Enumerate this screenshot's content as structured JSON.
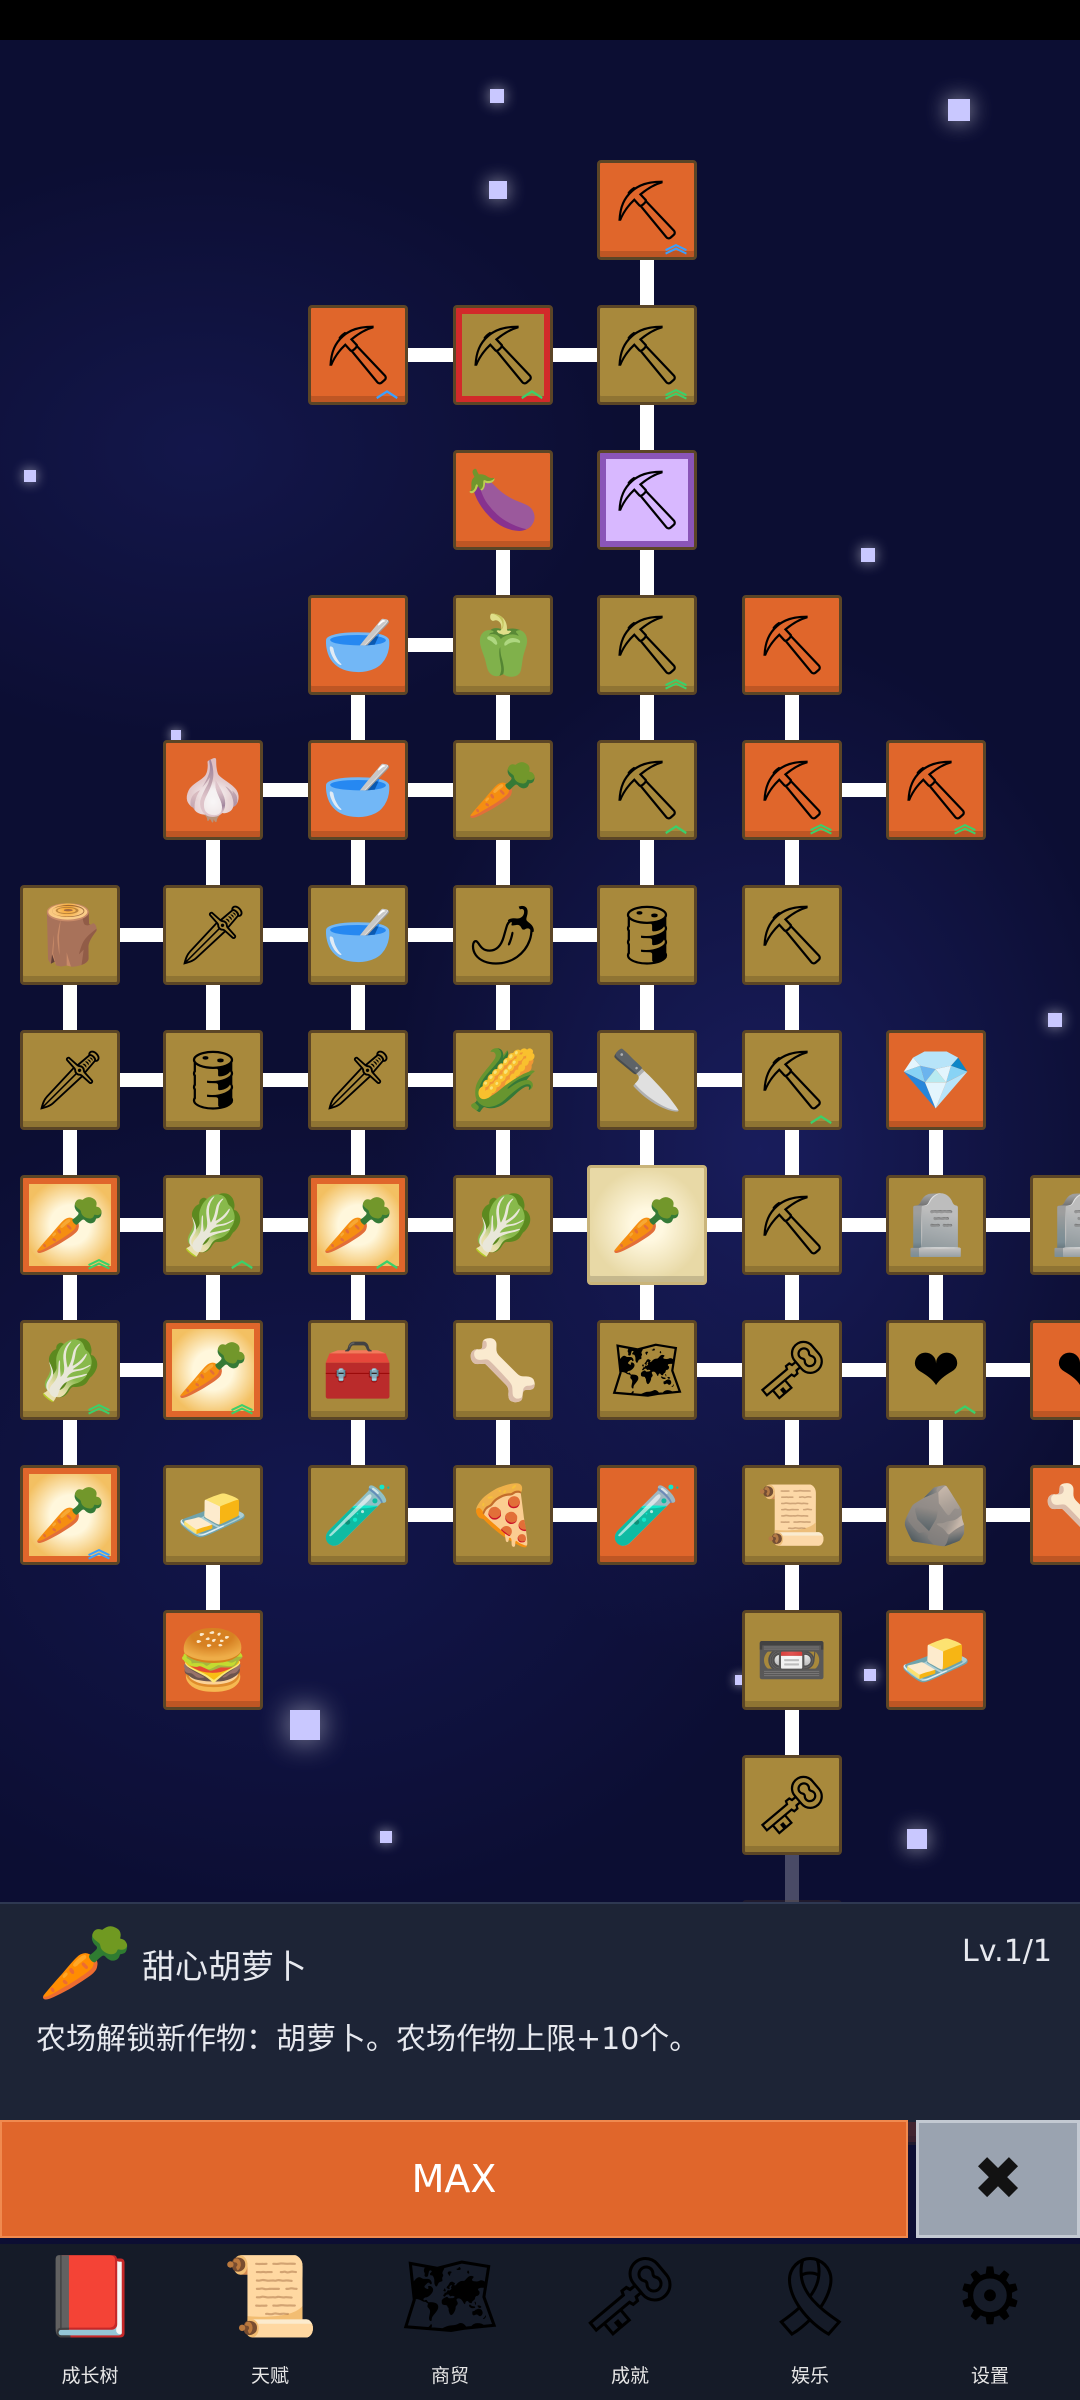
{
  "tree": {
    "nodes": [
      {
        "id": "n1",
        "col": 4,
        "row": 0,
        "bg": "orange",
        "icon": "shovel-icon",
        "glyph": "⛏",
        "up": "︽",
        "upColor": "#3aa0ff"
      },
      {
        "id": "n2",
        "col": 2,
        "row": 1,
        "bg": "orange",
        "icon": "shovel-icon",
        "glyph": "⛏",
        "up": "︿",
        "upColor": "#3aa0ff"
      },
      {
        "id": "n3",
        "col": 3,
        "row": 1,
        "bg": "red-frame",
        "icon": "shovel-icon",
        "glyph": "⛏",
        "up": "︿",
        "upColor": "#3ad06a"
      },
      {
        "id": "n4",
        "col": 4,
        "row": 1,
        "bg": "gold",
        "icon": "shovel-icon",
        "glyph": "⛏",
        "up": "︽",
        "upColor": "#3ad06a"
      },
      {
        "id": "n5",
        "col": 3,
        "row": 2,
        "bg": "orange",
        "icon": "eggplant-icon",
        "glyph": "🍆"
      },
      {
        "id": "n6",
        "col": 4,
        "row": 2,
        "bg": "purple",
        "icon": "shovel-icon",
        "glyph": "⛏"
      },
      {
        "id": "n7",
        "col": 2,
        "row": 3,
        "bg": "orange",
        "icon": "bowl-icon",
        "glyph": "🥣"
      },
      {
        "id": "n8",
        "col": 3,
        "row": 3,
        "bg": "gold",
        "icon": "pepper-icon",
        "glyph": "🫑"
      },
      {
        "id": "n9",
        "col": 4,
        "row": 3,
        "bg": "gold",
        "icon": "shovel-icon",
        "glyph": "⛏",
        "up": "︽",
        "upColor": "#3ad06a"
      },
      {
        "id": "n10",
        "col": 5,
        "row": 3,
        "bg": "orange",
        "icon": "pickaxe-icon",
        "glyph": "⛏"
      },
      {
        "id": "n11",
        "col": 1,
        "row": 4,
        "bg": "orange",
        "icon": "garlic-icon",
        "glyph": "🧄"
      },
      {
        "id": "n12",
        "col": 2,
        "row": 4,
        "bg": "orange",
        "icon": "bowl-icon",
        "glyph": "🥣"
      },
      {
        "id": "n13",
        "col": 3,
        "row": 4,
        "bg": "gold",
        "icon": "radish-icon",
        "glyph": "🥕"
      },
      {
        "id": "n14",
        "col": 4,
        "row": 4,
        "bg": "gold",
        "icon": "shovel-icon",
        "glyph": "⛏",
        "up": "︿",
        "upColor": "#3ad06a"
      },
      {
        "id": "n15",
        "col": 5,
        "row": 4,
        "bg": "orange",
        "icon": "pickaxe-icon",
        "glyph": "⛏",
        "up": "︽",
        "upColor": "#3ad06a"
      },
      {
        "id": "n16",
        "col": 6,
        "row": 4,
        "bg": "orange",
        "icon": "pickaxe-icon",
        "glyph": "⛏",
        "up": "︽",
        "upColor": "#3ad06a"
      },
      {
        "id": "n17",
        "col": 0,
        "row": 5,
        "bg": "gold",
        "icon": "fence-icon",
        "glyph": "🪵"
      },
      {
        "id": "n18",
        "col": 1,
        "row": 5,
        "bg": "gold",
        "icon": "sword-icon",
        "glyph": "🗡"
      },
      {
        "id": "n19",
        "col": 2,
        "row": 5,
        "bg": "gold",
        "icon": "bowl-icon",
        "glyph": "🥣"
      },
      {
        "id": "n20",
        "col": 3,
        "row": 5,
        "bg": "gold",
        "icon": "chili-icon",
        "glyph": "🌶"
      },
      {
        "id": "n21",
        "col": 4,
        "row": 5,
        "bg": "gold",
        "icon": "barrel-icon",
        "glyph": "🛢"
      },
      {
        "id": "n22",
        "col": 5,
        "row": 5,
        "bg": "gold",
        "icon": "pickaxe-icon",
        "glyph": "⛏"
      },
      {
        "id": "n23",
        "col": 0,
        "row": 6,
        "bg": "gold",
        "icon": "sword-icon",
        "glyph": "🗡"
      },
      {
        "id": "n24",
        "col": 1,
        "row": 6,
        "bg": "gold",
        "icon": "barrel-icon",
        "glyph": "🛢"
      },
      {
        "id": "n25",
        "col": 2,
        "row": 6,
        "bg": "gold",
        "icon": "sword-icon",
        "glyph": "🗡"
      },
      {
        "id": "n26",
        "col": 3,
        "row": 6,
        "bg": "gold",
        "icon": "corn-icon",
        "glyph": "🌽"
      },
      {
        "id": "n27",
        "col": 4,
        "row": 6,
        "bg": "gold",
        "icon": "dagger-icon",
        "glyph": "🔪"
      },
      {
        "id": "n28",
        "col": 5,
        "row": 6,
        "bg": "gold",
        "icon": "pickaxe-icon",
        "glyph": "⛏",
        "up": "︿",
        "upColor": "#3ad06a"
      },
      {
        "id": "n29",
        "col": 6,
        "row": 6,
        "bg": "orange",
        "icon": "crystal-icon",
        "glyph": "💎"
      },
      {
        "id": "n30",
        "col": 0,
        "row": 7,
        "bg": "carrot-frame",
        "icon": "carrot-icon",
        "glyph": "🥕",
        "up": "︽",
        "upColor": "#3ad06a"
      },
      {
        "id": "n31",
        "col": 1,
        "row": 7,
        "bg": "gold",
        "icon": "cabbage-icon",
        "glyph": "🥬",
        "up": "︿",
        "upColor": "#3ad06a"
      },
      {
        "id": "n32",
        "col": 2,
        "row": 7,
        "bg": "carrot-frame",
        "icon": "carrot-icon",
        "glyph": "🥕",
        "up": "︿",
        "upColor": "#3ad06a"
      },
      {
        "id": "n33",
        "col": 3,
        "row": 7,
        "bg": "gold",
        "icon": "cabbage-icon",
        "glyph": "🥬"
      },
      {
        "id": "n34",
        "col": 4,
        "row": 7,
        "bg": "selected",
        "icon": "carrot-icon",
        "glyph": "🥕"
      },
      {
        "id": "n35",
        "col": 5,
        "row": 7,
        "bg": "gold",
        "icon": "pickaxe-icon",
        "glyph": "⛏"
      },
      {
        "id": "n36",
        "col": 6,
        "row": 7,
        "bg": "gold",
        "icon": "tombstone-icon",
        "glyph": "🪦"
      },
      {
        "id": "n37",
        "col": 7,
        "row": 7,
        "bg": "gold",
        "icon": "tombstone-icon",
        "glyph": "🪦"
      },
      {
        "id": "n38",
        "col": 0,
        "row": 8,
        "bg": "gold",
        "icon": "cabbage-icon",
        "glyph": "🥬",
        "up": "︽",
        "upColor": "#3ad06a"
      },
      {
        "id": "n39",
        "col": 1,
        "row": 8,
        "bg": "carrot-frame",
        "icon": "carrot-icon",
        "glyph": "🥕",
        "up": "︽",
        "upColor": "#3ad06a"
      },
      {
        "id": "n40",
        "col": 2,
        "row": 8,
        "bg": "gold",
        "icon": "chest-icon",
        "glyph": "🧰"
      },
      {
        "id": "n41",
        "col": 3,
        "row": 8,
        "bg": "gold",
        "icon": "bone-icon",
        "glyph": "🦴"
      },
      {
        "id": "n42",
        "col": 4,
        "row": 8,
        "bg": "gold",
        "icon": "map-icon",
        "glyph": "🗺"
      },
      {
        "id": "n43",
        "col": 5,
        "row": 8,
        "bg": "gold",
        "icon": "key-icon",
        "glyph": "🗝"
      },
      {
        "id": "n44",
        "col": 6,
        "row": 8,
        "bg": "gold",
        "icon": "heart-icon",
        "glyph": "❤",
        "up": "︿",
        "upColor": "#3ad06a"
      },
      {
        "id": "n45",
        "col": 7,
        "row": 8,
        "bg": "orange",
        "icon": "heart-icon",
        "glyph": "❤"
      },
      {
        "id": "n46",
        "col": 0,
        "row": 9,
        "bg": "carrot-frame",
        "icon": "carrot-icon",
        "glyph": "🥕",
        "up": "︽",
        "upColor": "#3aa0ff"
      },
      {
        "id": "n47",
        "col": 1,
        "row": 9,
        "bg": "gold",
        "icon": "gold-bar-icon",
        "glyph": "🧈"
      },
      {
        "id": "n48",
        "col": 2,
        "row": 9,
        "bg": "gold",
        "icon": "potion-icon",
        "glyph": "🧪"
      },
      {
        "id": "n49",
        "col": 3,
        "row": 9,
        "bg": "gold",
        "icon": "pizza-icon",
        "glyph": "🍕"
      },
      {
        "id": "n50",
        "col": 4,
        "row": 9,
        "bg": "orange",
        "icon": "potion-icon",
        "glyph": "🧪"
      },
      {
        "id": "n51",
        "col": 5,
        "row": 9,
        "bg": "gold",
        "icon": "scroll-icon",
        "glyph": "📜"
      },
      {
        "id": "n52",
        "col": 6,
        "row": 9,
        "bg": "gold",
        "icon": "fossil-icon",
        "glyph": "🪨"
      },
      {
        "id": "n53",
        "col": 7,
        "row": 9,
        "bg": "orange",
        "icon": "bone-icon",
        "glyph": "🦴"
      },
      {
        "id": "n54",
        "col": 1,
        "row": 10,
        "bg": "orange",
        "icon": "burger-icon",
        "glyph": "🍔"
      },
      {
        "id": "n55",
        "col": 5,
        "row": 10,
        "bg": "gold",
        "icon": "cassette-icon",
        "glyph": "📼"
      },
      {
        "id": "n56",
        "col": 6,
        "row": 10,
        "bg": "orange",
        "icon": "gold-bar-icon",
        "glyph": "🧈"
      },
      {
        "id": "n57",
        "col": 5,
        "row": 11,
        "bg": "gold",
        "icon": "key-icon",
        "glyph": "🗝"
      },
      {
        "id": "n58",
        "col": 5,
        "row": 12,
        "bg": "gold",
        "icon": "scroll-icon",
        "glyph": "📜",
        "dim": true
      },
      {
        "id": "n59",
        "col": 5,
        "row": 13,
        "bg": "gold",
        "icon": "stone-icon",
        "glyph": "🪨",
        "dim": true
      },
      {
        "id": "n60",
        "col": 6,
        "row": 13,
        "bg": "orange",
        "icon": "dragon-icon",
        "glyph": "🐉",
        "dim": true
      }
    ],
    "links": [
      [
        "n1",
        "n4"
      ],
      [
        "n2",
        "n3"
      ],
      [
        "n3",
        "n4"
      ],
      [
        "n4",
        "n6"
      ],
      [
        "n5",
        "n8"
      ],
      [
        "n6",
        "n9"
      ],
      [
        "n7",
        "n8"
      ],
      [
        "n7",
        "n12"
      ],
      [
        "n8",
        "n13"
      ],
      [
        "n9",
        "n14"
      ],
      [
        "n10",
        "n15"
      ],
      [
        "n11",
        "n12"
      ],
      [
        "n12",
        "n13"
      ],
      [
        "n11",
        "n18"
      ],
      [
        "n12",
        "n19"
      ],
      [
        "n13",
        "n20"
      ],
      [
        "n14",
        "n21"
      ],
      [
        "n15",
        "n16"
      ],
      [
        "n15",
        "n22"
      ],
      [
        "n17",
        "n18"
      ],
      [
        "n18",
        "n19"
      ],
      [
        "n19",
        "n20"
      ],
      [
        "n20",
        "n21"
      ],
      [
        "n17",
        "n23"
      ],
      [
        "n18",
        "n24"
      ],
      [
        "n19",
        "n25"
      ],
      [
        "n20",
        "n26"
      ],
      [
        "n21",
        "n27"
      ],
      [
        "n22",
        "n28"
      ],
      [
        "n23",
        "n24"
      ],
      [
        "n24",
        "n25"
      ],
      [
        "n25",
        "n26"
      ],
      [
        "n26",
        "n27"
      ],
      [
        "n27",
        "n28"
      ],
      [
        "n23",
        "n30"
      ],
      [
        "n24",
        "n31"
      ],
      [
        "n25",
        "n32"
      ],
      [
        "n26",
        "n33"
      ],
      [
        "n27",
        "n34"
      ],
      [
        "n28",
        "n35"
      ],
      [
        "n29",
        "n36"
      ],
      [
        "n30",
        "n31"
      ],
      [
        "n31",
        "n32"
      ],
      [
        "n32",
        "n33"
      ],
      [
        "n33",
        "n34"
      ],
      [
        "n34",
        "n35"
      ],
      [
        "n35",
        "n36"
      ],
      [
        "n36",
        "n37"
      ],
      [
        "n30",
        "n38"
      ],
      [
        "n31",
        "n39"
      ],
      [
        "n32",
        "n40"
      ],
      [
        "n33",
        "n41"
      ],
      [
        "n34",
        "n42"
      ],
      [
        "n35",
        "n43"
      ],
      [
        "n36",
        "n44"
      ],
      [
        "n38",
        "n39"
      ],
      [
        "n42",
        "n43"
      ],
      [
        "n43",
        "n44"
      ],
      [
        "n44",
        "n45"
      ],
      [
        "n38",
        "n46"
      ],
      [
        "n40",
        "n48"
      ],
      [
        "n41",
        "n49"
      ],
      [
        "n43",
        "n51"
      ],
      [
        "n44",
        "n52"
      ],
      [
        "n45",
        "n53"
      ],
      [
        "n48",
        "n49"
      ],
      [
        "n49",
        "n50"
      ],
      [
        "n51",
        "n52"
      ],
      [
        "n52",
        "n53"
      ],
      [
        "n47",
        "n54"
      ],
      [
        "n51",
        "n55"
      ],
      [
        "n52",
        "n56"
      ],
      [
        "n55",
        "n57"
      ],
      [
        "n57",
        "n58"
      ],
      [
        "n58",
        "n59"
      ],
      [
        "n59",
        "n60"
      ]
    ]
  },
  "panel": {
    "icon": "carrot-icon",
    "glyph": "🥕",
    "name": "甜心胡萝卜",
    "level": "Lv.1/1",
    "description": "农场解锁新作物：胡萝卜。农场作物上限+10个。"
  },
  "actions": {
    "max_label": "MAX",
    "close_glyph": "✖"
  },
  "nav": [
    {
      "label": "成长树",
      "icon": "book-icon",
      "glyph": "📕"
    },
    {
      "label": "天赋",
      "icon": "scroll-icon",
      "glyph": "📜"
    },
    {
      "label": "商贸",
      "icon": "map-icon",
      "glyph": "🗺"
    },
    {
      "label": "成就",
      "icon": "key-icon",
      "glyph": "🗝"
    },
    {
      "label": "娱乐",
      "icon": "ribbon-icon",
      "glyph": "🎗"
    },
    {
      "label": "设置",
      "icon": "gear-icon",
      "glyph": "⚙"
    }
  ],
  "colors": {
    "gold": "#a8893c",
    "orange": "#e0662b",
    "purple": "#8a55b8",
    "selected": "#efe6c4",
    "accent": "#e0662b"
  }
}
